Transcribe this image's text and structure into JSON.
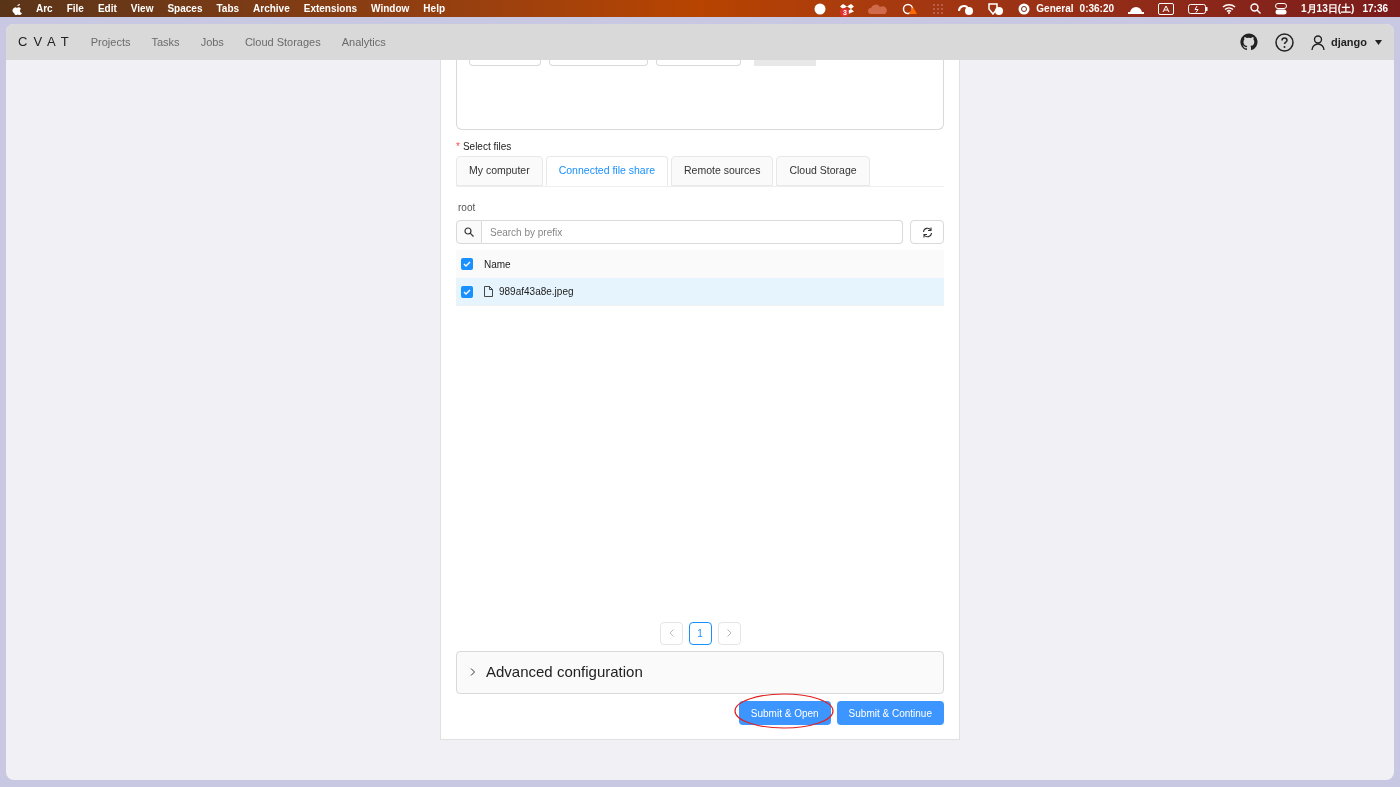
{
  "menu_bar": {
    "app": "Arc",
    "items": [
      "File",
      "Edit",
      "View",
      "Spaces",
      "Tabs",
      "Archive",
      "Extensions",
      "Window",
      "Help"
    ],
    "status": {
      "focus_label": "General",
      "timer": "0:36:20",
      "badge": "3",
      "date": "1月13日(土)",
      "time": "17:36"
    }
  },
  "nav": {
    "logo": "CVAT",
    "links": [
      "Projects",
      "Tasks",
      "Jobs",
      "Cloud Storages",
      "Analytics"
    ],
    "user": "django"
  },
  "select_files": {
    "required_mark": "*",
    "label": "Select files",
    "tabs": [
      {
        "label": "My computer",
        "selected": false
      },
      {
        "label": "Connected file share",
        "selected": true
      },
      {
        "label": "Remote sources",
        "selected": false
      },
      {
        "label": "Cloud Storage",
        "selected": false
      }
    ],
    "path": "root",
    "search": {
      "placeholder": "Search by prefix"
    },
    "table": {
      "header_checked": true,
      "column": "Name",
      "rows": [
        {
          "name": "989af43a8e.jpeg",
          "checked": true,
          "selected": true
        }
      ]
    },
    "pagination": [
      {
        "label": "1",
        "selected": true
      }
    ]
  },
  "advanced": {
    "label": "Advanced configuration",
    "expanded": false
  },
  "buttons": [
    {
      "label": "Submit & Open",
      "circled": true
    },
    {
      "label": "Submit & Continue",
      "circled": false
    }
  ]
}
